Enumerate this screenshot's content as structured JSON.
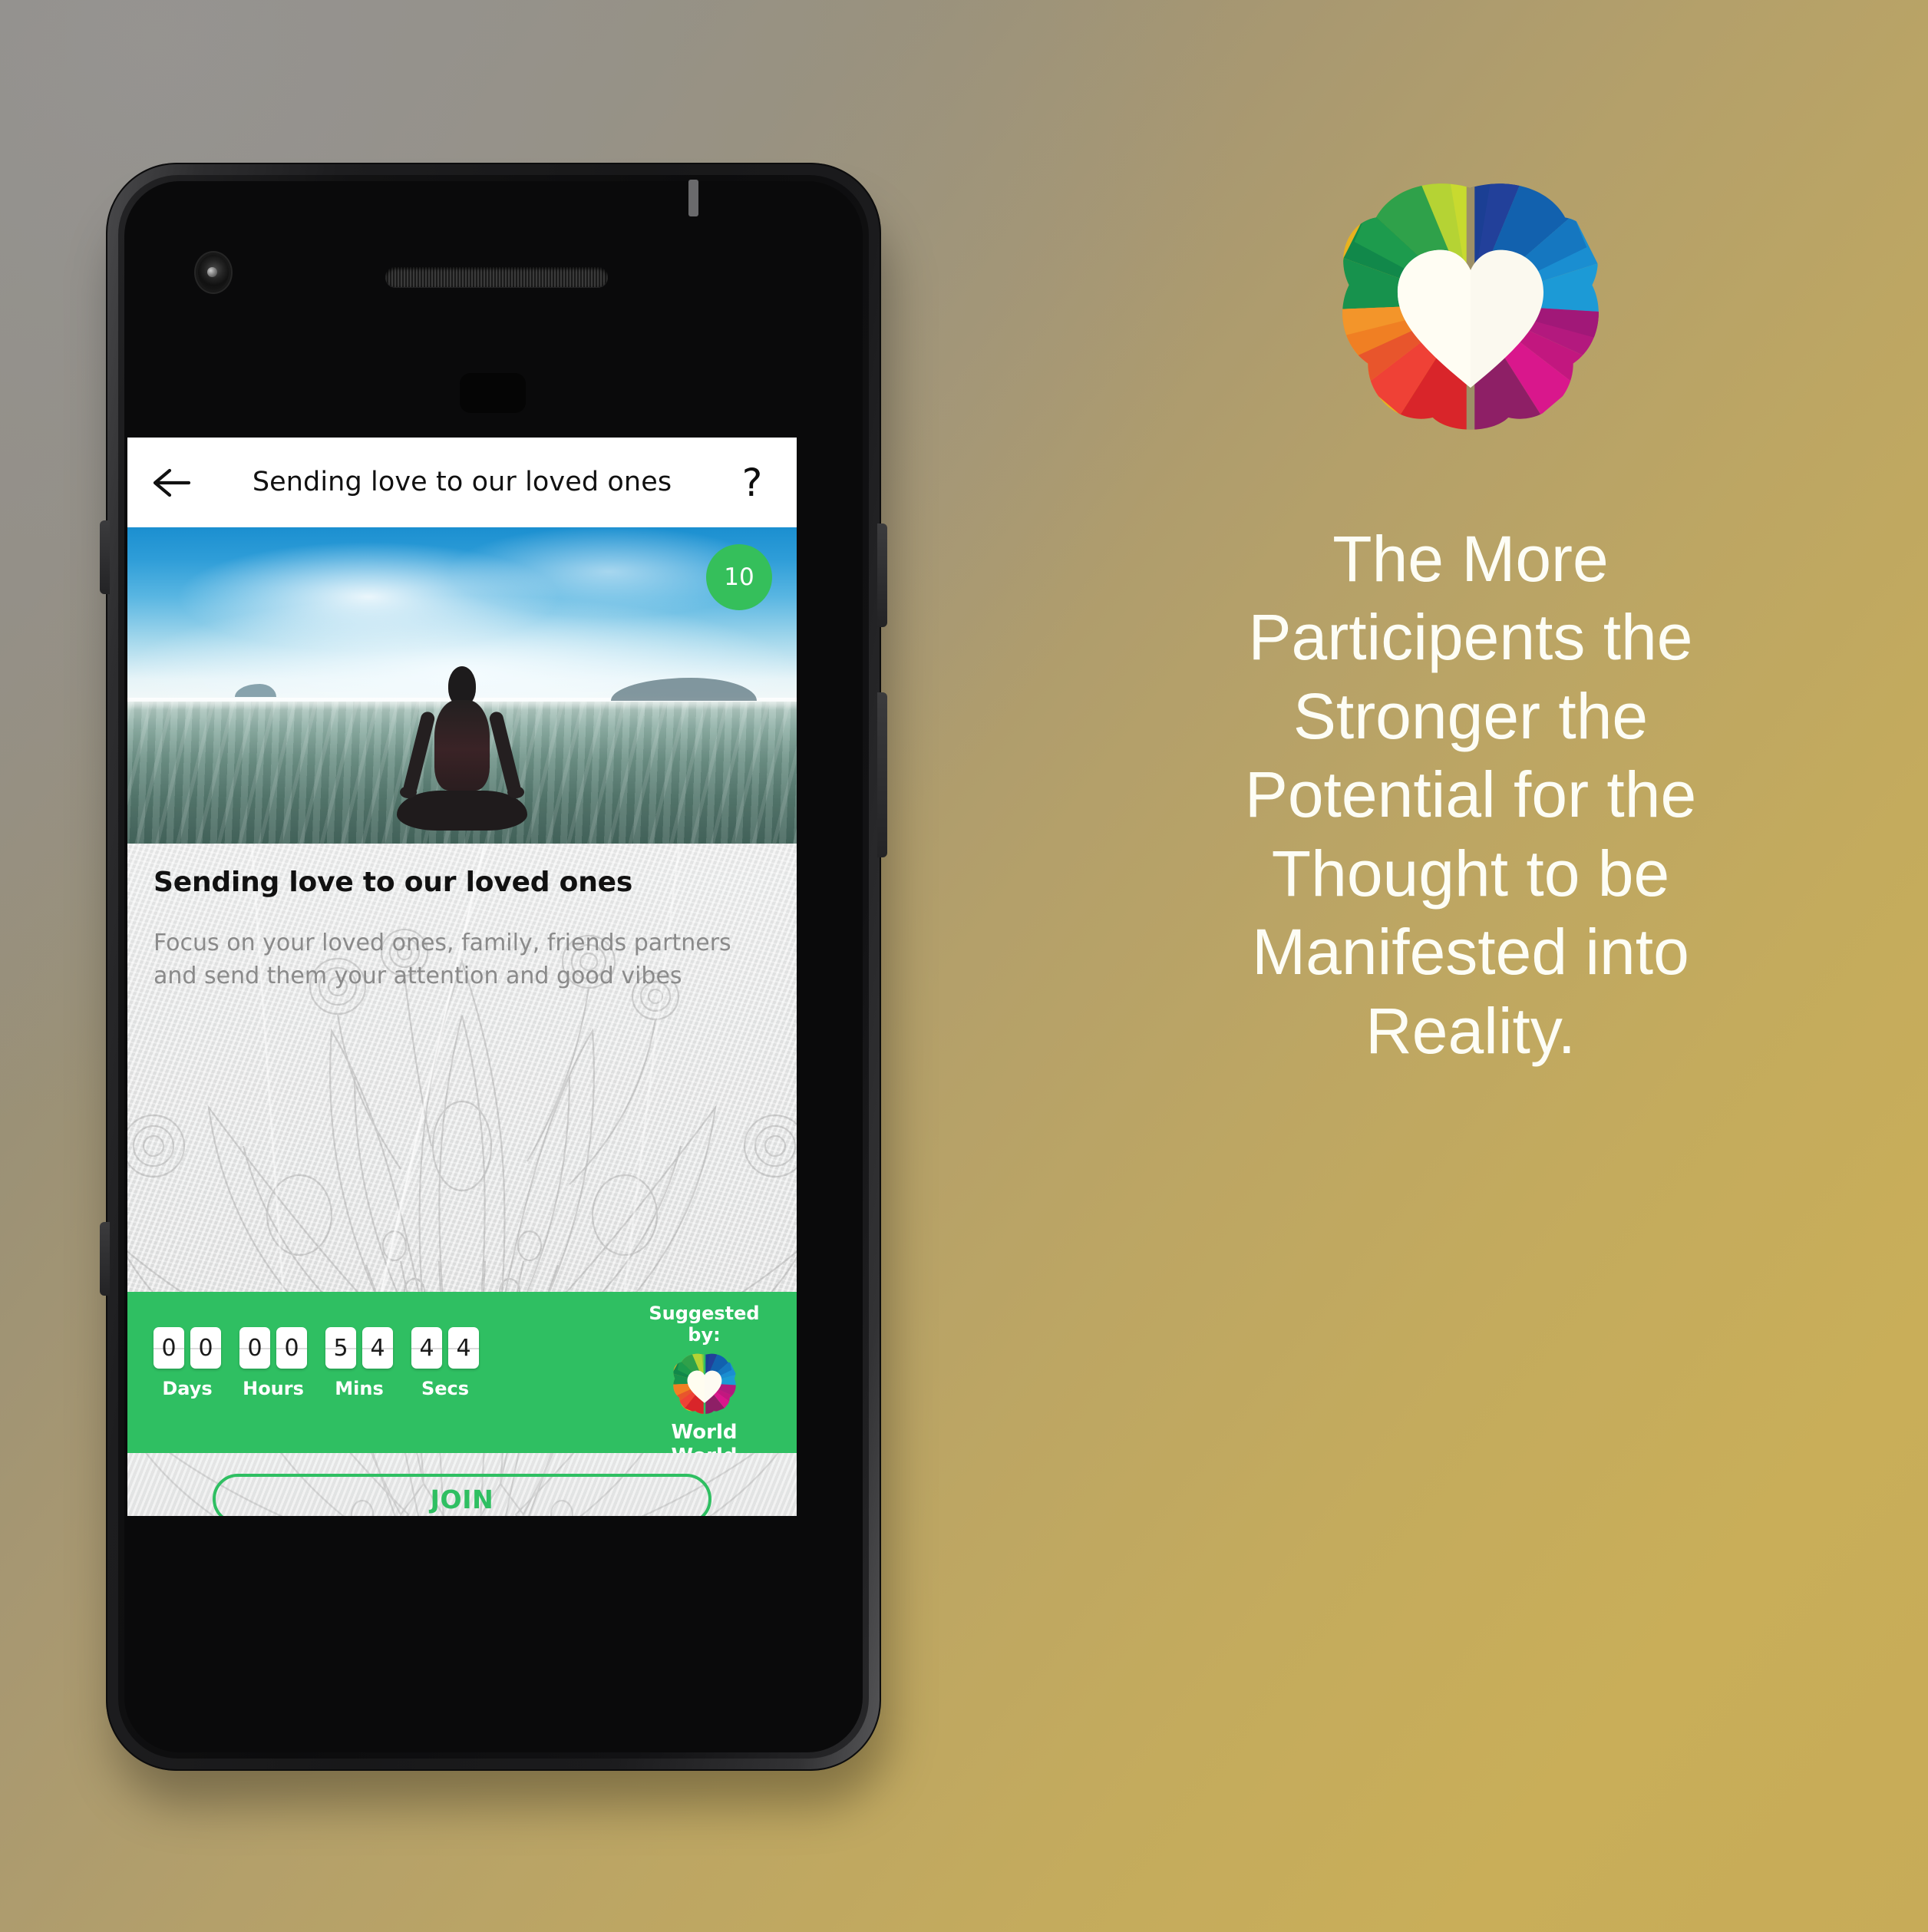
{
  "app": {
    "header": {
      "back_icon": "arrow-left-icon",
      "title": "Sending love to our loved ones",
      "help_icon": "question-mark-icon",
      "help_label": "?"
    },
    "hero": {
      "image_alt": "meditation-silhouette-beach",
      "participants_count": "10"
    },
    "session": {
      "title": "Sending love to our loved ones",
      "description": "Focus on your loved ones, family, friends partners and send them your attention and good vibes"
    },
    "countdown": {
      "groups": [
        {
          "label": "Days",
          "digits": [
            "0",
            "0"
          ]
        },
        {
          "label": "Hours",
          "digits": [
            "0",
            "0"
          ]
        },
        {
          "label": "Mins",
          "digits": [
            "5",
            "4"
          ]
        },
        {
          "label": "Secs",
          "digits": [
            "4",
            "4"
          ]
        }
      ]
    },
    "suggested": {
      "label": "Suggested by:",
      "logo_icon": "brain-heart-logo-icon",
      "name_line1": "World",
      "name_line2": "World"
    },
    "join": {
      "label": "JOIN"
    }
  },
  "brand": {
    "logo_icon": "brain-heart-logo-icon",
    "tagline": "The More Participents the Stronger the Potential for the Thought to be Manifested into Reality."
  },
  "colors": {
    "accent_green": "#2fbf62",
    "badge_green": "#35bf5b",
    "paper_gray": "#e6e7e7",
    "tagline_white": "#fdfdf5",
    "background_gold": "#c7ab58",
    "background_gray": "#8d8a85"
  }
}
